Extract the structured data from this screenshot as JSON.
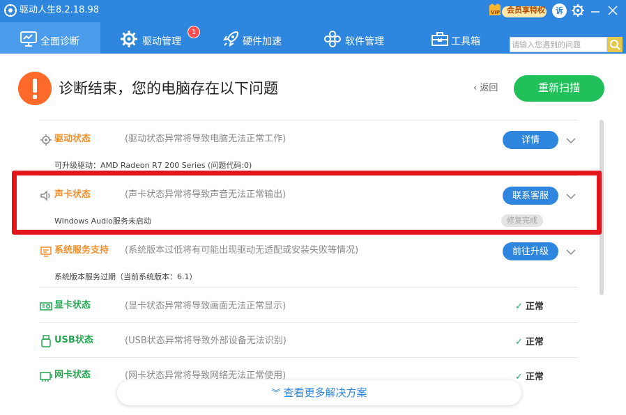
{
  "titlebar": {
    "app_title": "驱动人生8.2.18.98",
    "vip_label": "会员享特权",
    "feedback_label": "诉"
  },
  "nav": {
    "tabs": [
      {
        "label": "全面诊断",
        "icon": "monitor-chart-icon",
        "active": true
      },
      {
        "label": "驱动管理",
        "icon": "gear-icon",
        "badge": "1"
      },
      {
        "label": "硬件加速",
        "icon": "rocket-icon"
      },
      {
        "label": "软件管理",
        "icon": "flower-apps-icon"
      },
      {
        "label": "工具箱",
        "icon": "toolbox-icon"
      }
    ],
    "search_placeholder": "请输入您遇到的问题"
  },
  "header": {
    "title": "诊断结束，您的电脑存在以下问题",
    "back_label": "返回",
    "rescan_label": "重新扫描"
  },
  "rows": [
    {
      "title": "驱动状态",
      "desc": "(驱动状态异常将导致电脑无法正常工作)",
      "detail": "可升级驱动：AMD Radeon R7 200 Series (问题代码:0)",
      "action": "详情"
    },
    {
      "title": "声卡状态",
      "desc": "(声卡状态异常将导致声音无法正常输出)",
      "detail": "Windows Audio服务未启动",
      "action": "联系客服",
      "status_badge": "修复完成"
    },
    {
      "title": "系统服务支持",
      "desc": "(系统版本过低将有可能出现驱动无适配或安装失败等情况)",
      "detail": "系统版本服务过期（当前系统版本：6.1）",
      "action": "前往升级"
    },
    {
      "title": "显卡状态",
      "desc": "(显卡状态异常将导致画面无法正常显示)",
      "status": "正常"
    },
    {
      "title": "USB状态",
      "desc": "(USB状态异常将导致外部设备无法识别)",
      "status": "正常"
    },
    {
      "title": "网卡状态",
      "desc": "(网卡状态异常将导致网络无法正常使用)",
      "status": "正常"
    }
  ],
  "footer": {
    "more_label": "查看更多解决方案"
  },
  "colors": {
    "brand_blue": "#2e86de",
    "green": "#22c05b",
    "warning_orange": "#f2902e",
    "highlight_red": "#e3161d"
  }
}
